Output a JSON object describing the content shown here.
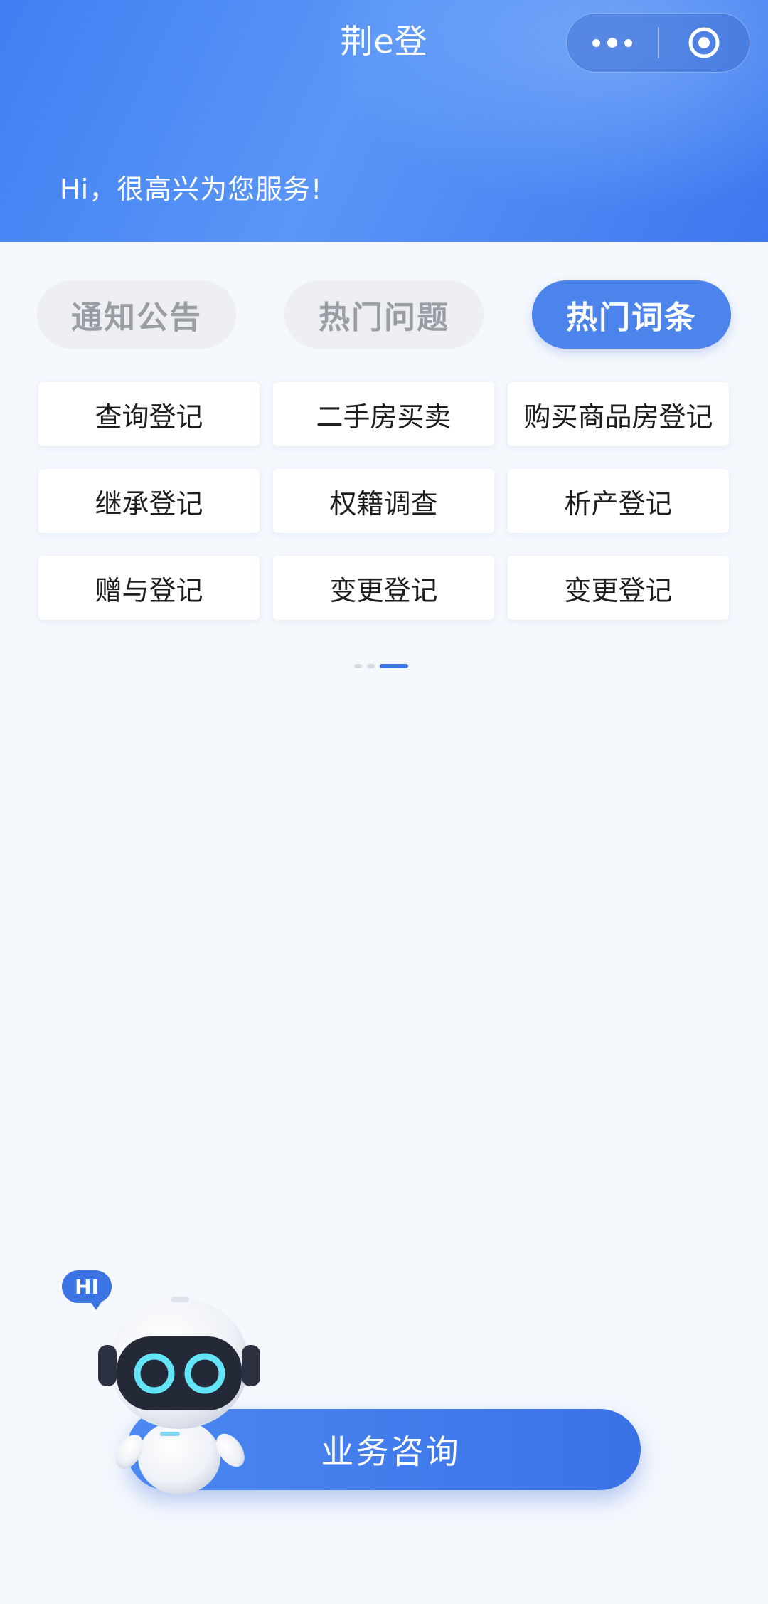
{
  "header": {
    "title": "荆e登",
    "greeting": "Hi，很高兴为您服务!"
  },
  "tabs": [
    {
      "label": "通知公告",
      "active": false
    },
    {
      "label": "热门问题",
      "active": false
    },
    {
      "label": "热门词条",
      "active": true
    }
  ],
  "keywords": [
    "查询登记",
    "二手房买卖",
    "购买商品房登记",
    "继承登记",
    "权籍调查",
    "析产登记",
    "赠与登记",
    "变更登记",
    "变更登记"
  ],
  "pager": {
    "pages": 3,
    "current": 3
  },
  "assistant": {
    "badge": "HI",
    "button_label": "业务咨询"
  },
  "colors": {
    "brand_blue": "#4c84ec",
    "header_gradient_start": "#3f7ff2",
    "page_bg": "#f5f8fd"
  }
}
